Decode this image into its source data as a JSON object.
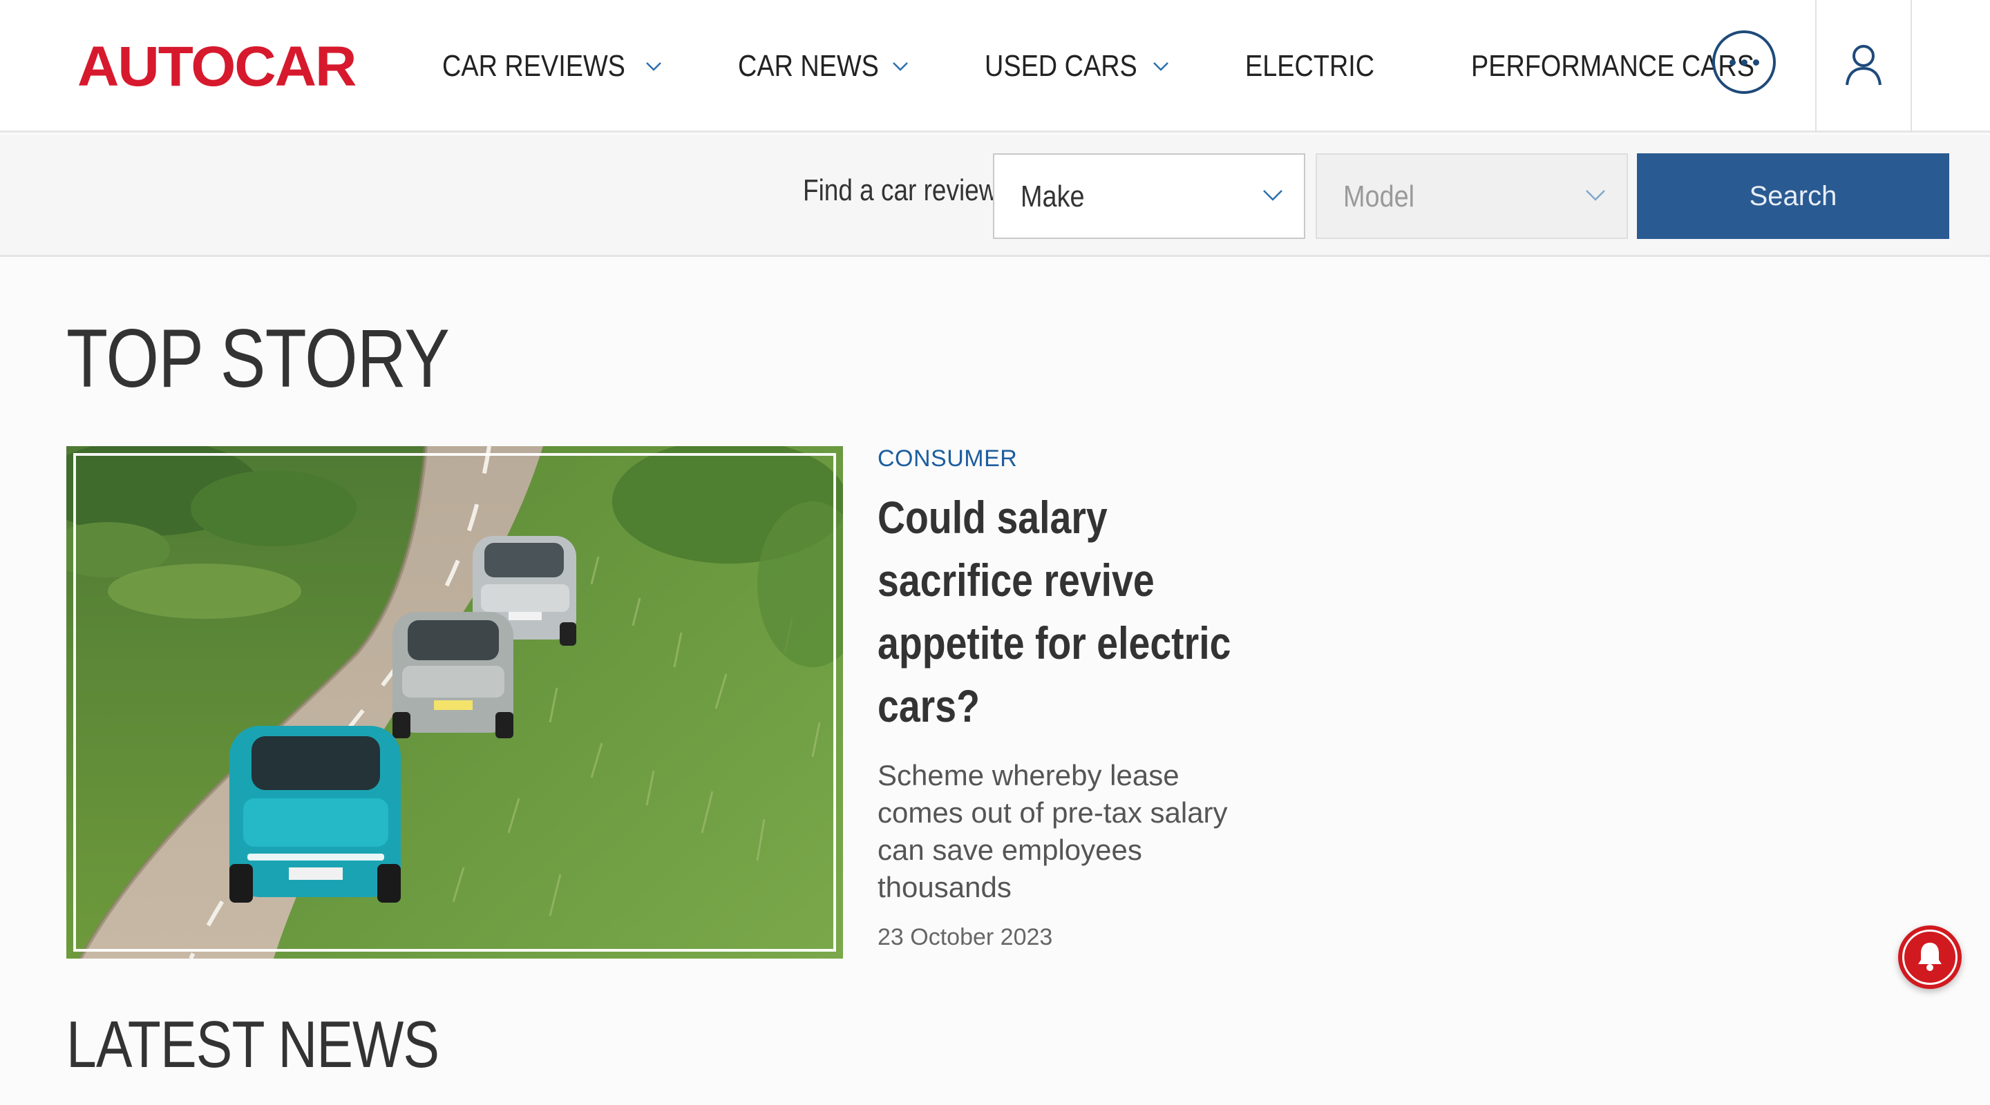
{
  "header": {
    "logo_text": "AUTOCAR",
    "brand_color": "#d7192d",
    "nav": [
      {
        "label": "CAR REVIEWS",
        "has_dropdown": true
      },
      {
        "label": "CAR NEWS",
        "has_dropdown": true
      },
      {
        "label": "USED CARS",
        "has_dropdown": true
      },
      {
        "label": "ELECTRIC",
        "has_dropdown": false
      },
      {
        "label": "PERFORMANCE CARS",
        "has_dropdown": false
      }
    ],
    "more_icon": "ellipsis-circle-icon",
    "account_icon": "user-icon"
  },
  "search_bar": {
    "label": "Find a car review",
    "make_select": "Make",
    "model_select": "Model",
    "button": "Search",
    "button_color": "#2a5a92"
  },
  "top_story": {
    "section_title": "TOP STORY",
    "category": "CONSUMER",
    "headline": "Could salary sacrifice revive appetite for electric cars?",
    "standfirst": "Scheme whereby lease comes out of pre-tax salary can save employees thousands",
    "date": "23 October 2023"
  },
  "latest_news": {
    "section_title": "LATEST NEWS"
  },
  "notification_icon": "bell-icon"
}
